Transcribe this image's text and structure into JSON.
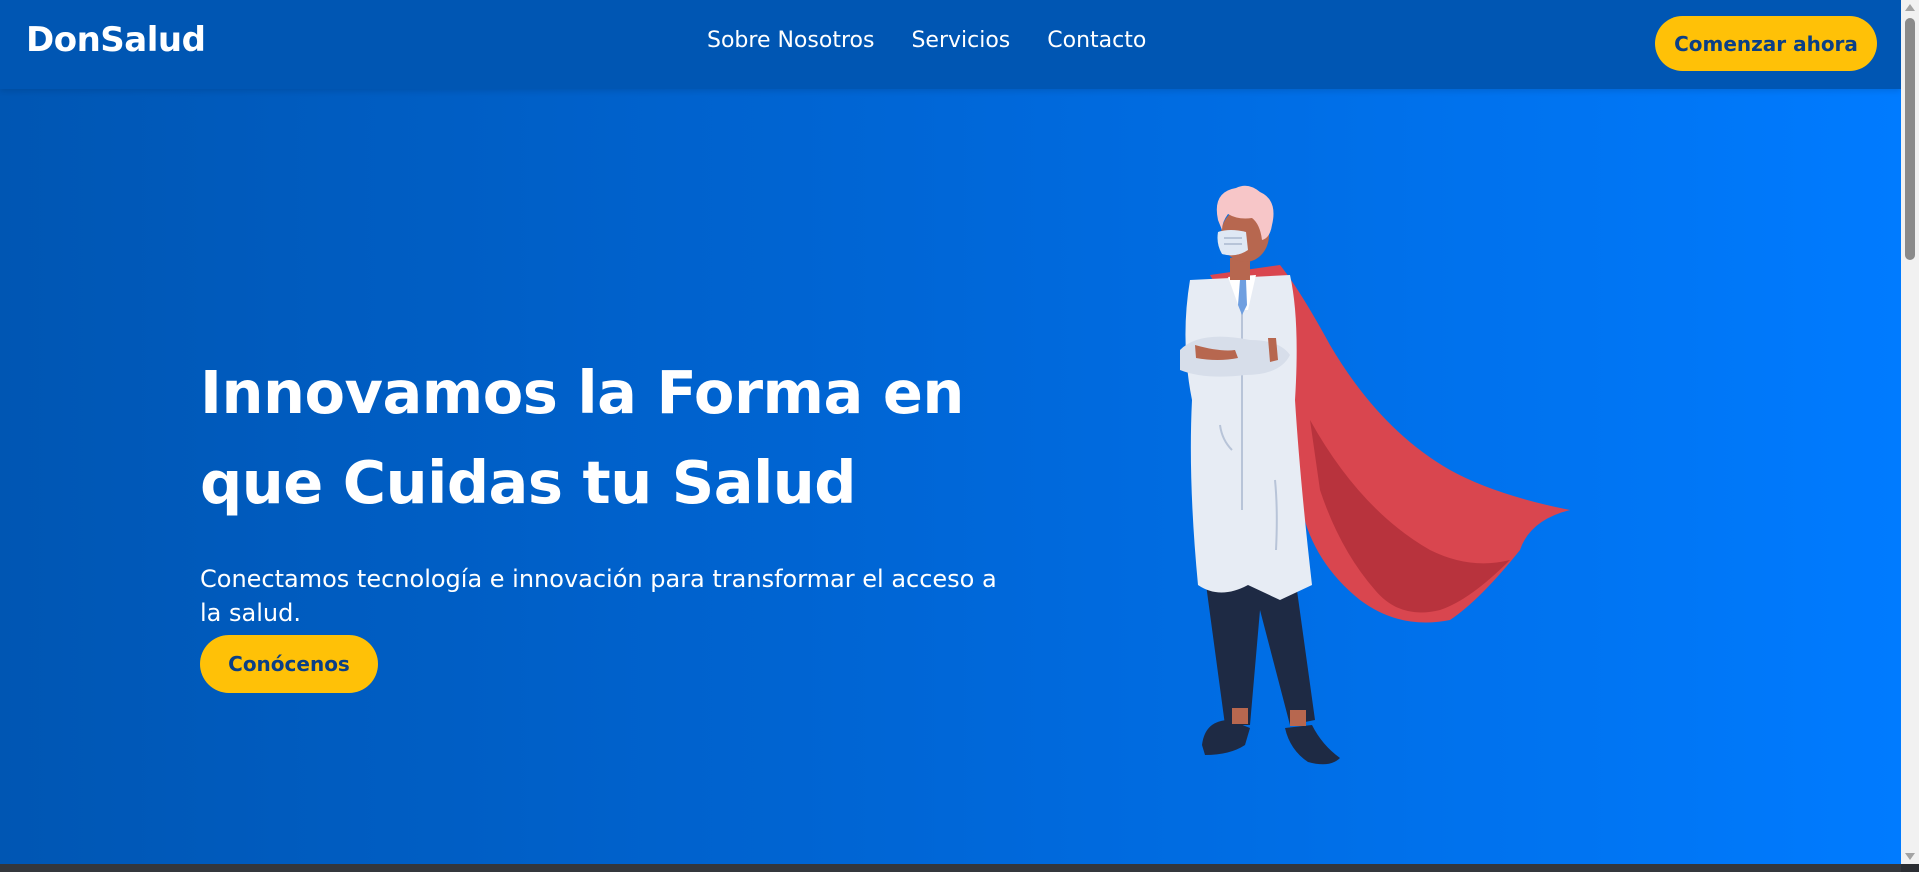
{
  "brand": {
    "name": "DonSalud"
  },
  "nav": {
    "links": [
      "Sobre Nosotros",
      "Servicios",
      "Contacto"
    ],
    "cta_label": "Comenzar ahora"
  },
  "hero": {
    "title_line1": "Innovamos la Forma en",
    "title_line2": "que Cuidas tu Salud",
    "subtitle": "Conectamos tecnología e innovación para transformar el acceso a la salud.",
    "button_label": "Conócenos",
    "illustration": "doctor-superhero-illustration"
  },
  "colors": {
    "navbar_bg": "#0056b3",
    "hero_gradient_start": "#0056b3",
    "hero_gradient_end": "#007bff",
    "accent": "#ffc107",
    "button_text": "#0b3f86",
    "cape_red": "#d9464f"
  },
  "icons": {
    "scroll_up": "chevron-up-icon",
    "scroll_down": "chevron-down-icon"
  }
}
